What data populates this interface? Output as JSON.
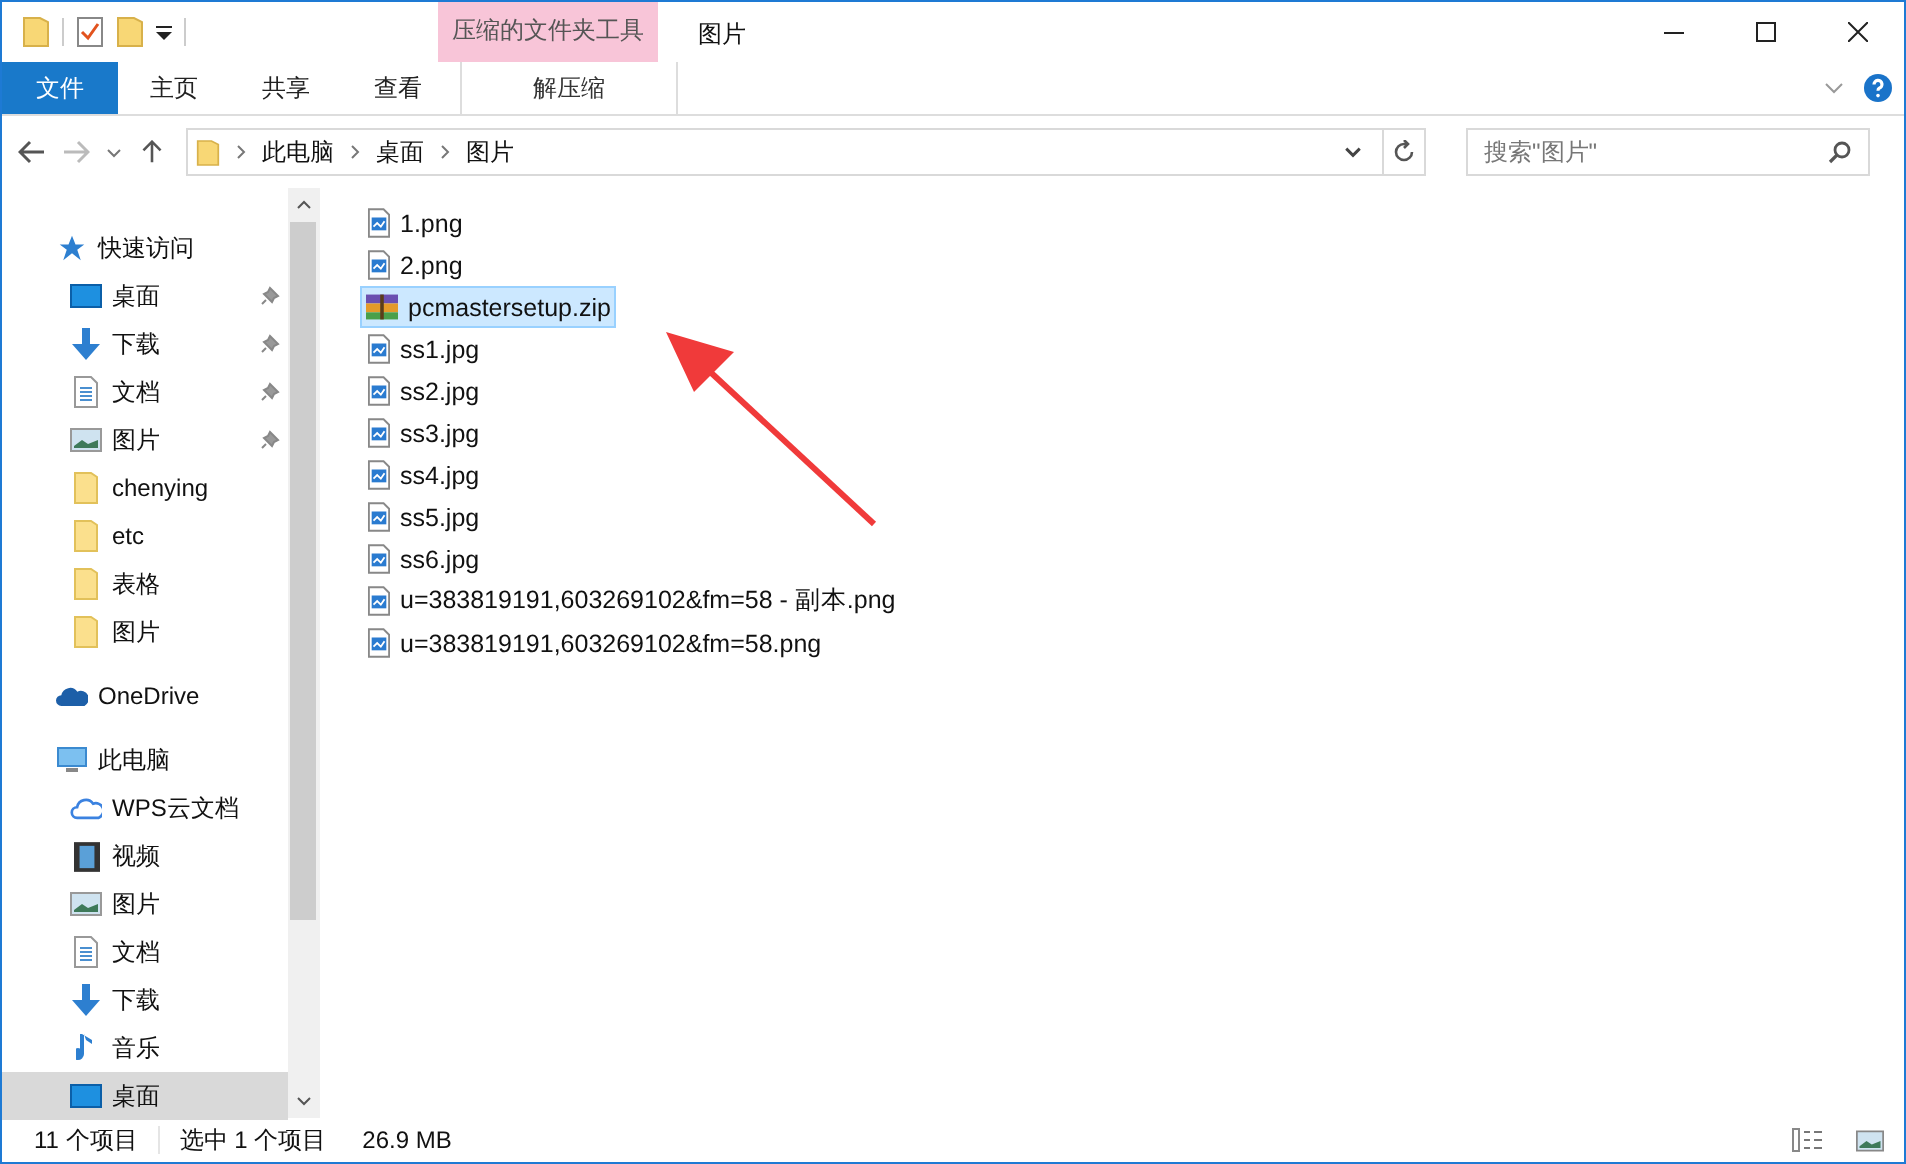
{
  "window": {
    "title": "图片",
    "context_group": "压缩的文件夹工具"
  },
  "ribbon_tabs": [
    {
      "label": "文件",
      "kind": "file"
    },
    {
      "label": "主页",
      "kind": "tab"
    },
    {
      "label": "共享",
      "kind": "tab"
    },
    {
      "label": "查看",
      "kind": "tab"
    },
    {
      "label": "解压缩",
      "kind": "context"
    }
  ],
  "address": {
    "crumbs": [
      "此电脑",
      "桌面",
      "图片"
    ]
  },
  "search": {
    "placeholder": "搜索\"图片\""
  },
  "sidebar": {
    "items": [
      {
        "label": "快速访问",
        "kind": "star",
        "selected": false,
        "children": [
          {
            "label": "桌面",
            "kind": "desktop",
            "pinned": true,
            "selected": false
          },
          {
            "label": "下载",
            "kind": "download",
            "pinned": true,
            "selected": false
          },
          {
            "label": "文档",
            "kind": "doc",
            "pinned": true,
            "selected": false
          },
          {
            "label": "图片",
            "kind": "pics",
            "pinned": true,
            "selected": false
          },
          {
            "label": "chenying",
            "kind": "folder",
            "pinned": false,
            "selected": false
          },
          {
            "label": "etc",
            "kind": "folder",
            "pinned": false,
            "selected": false
          },
          {
            "label": "表格",
            "kind": "folder",
            "pinned": false,
            "selected": false
          },
          {
            "label": "图片",
            "kind": "folder",
            "pinned": false,
            "selected": false
          }
        ]
      },
      {
        "label": "OneDrive",
        "kind": "cloud",
        "selected": false
      },
      {
        "label": "此电脑",
        "kind": "pc",
        "selected": false,
        "children": [
          {
            "label": "WPS云文档",
            "kind": "wps",
            "selected": false
          },
          {
            "label": "视频",
            "kind": "video",
            "selected": false
          },
          {
            "label": "图片",
            "kind": "pics",
            "selected": false
          },
          {
            "label": "文档",
            "kind": "doc",
            "selected": false
          },
          {
            "label": "下载",
            "kind": "download",
            "selected": false
          },
          {
            "label": "音乐",
            "kind": "music",
            "selected": false
          },
          {
            "label": "桌面",
            "kind": "desktop",
            "selected": true
          }
        ]
      }
    ]
  },
  "files": [
    {
      "name": "1.png",
      "kind": "image",
      "selected": false
    },
    {
      "name": "2.png",
      "kind": "image",
      "selected": false
    },
    {
      "name": "pcmastersetup.zip",
      "kind": "zip",
      "selected": true
    },
    {
      "name": "ss1.jpg",
      "kind": "image",
      "selected": false
    },
    {
      "name": "ss2.jpg",
      "kind": "image",
      "selected": false
    },
    {
      "name": "ss3.jpg",
      "kind": "image",
      "selected": false
    },
    {
      "name": "ss4.jpg",
      "kind": "image",
      "selected": false
    },
    {
      "name": "ss5.jpg",
      "kind": "image",
      "selected": false
    },
    {
      "name": "ss6.jpg",
      "kind": "image",
      "selected": false
    },
    {
      "name": "u=383819191,603269102&fm=58 - 副本.png",
      "kind": "image",
      "selected": false
    },
    {
      "name": "u=383819191,603269102&fm=58.png",
      "kind": "image",
      "selected": false
    }
  ],
  "status_bar": {
    "item_count": "11 个项目",
    "selection": "选中 1 个项目",
    "size": "26.9 MB"
  }
}
